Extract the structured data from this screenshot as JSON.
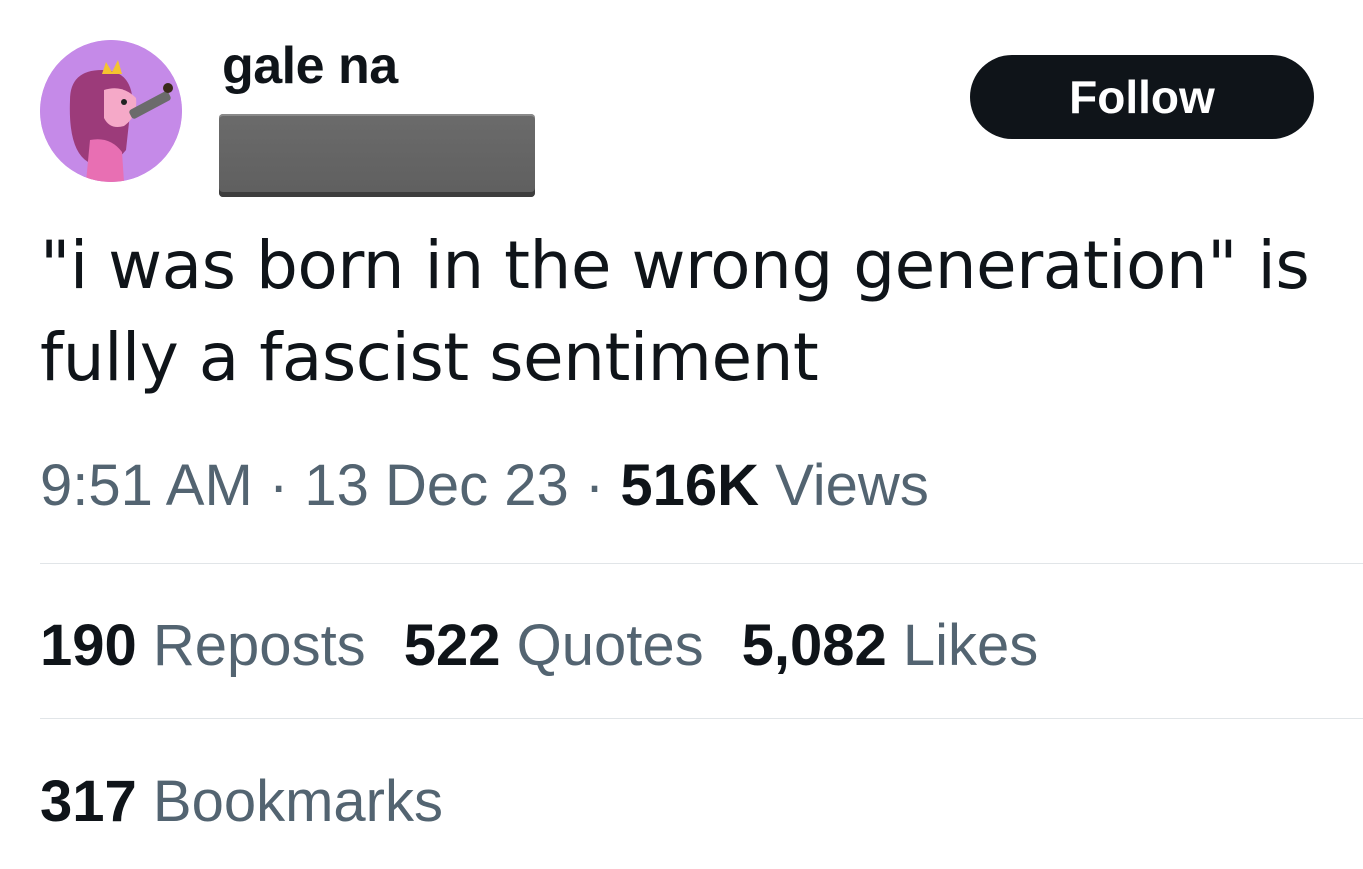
{
  "user": {
    "display_name": "gale na",
    "avatar_icon": "princess-bubblegum-avatar-icon",
    "avatar_bg": "#c58ae8"
  },
  "follow_button": {
    "label": "Follow"
  },
  "tweet": {
    "line1": "\"i was born in the wrong generation\" is",
    "line2": "fully a fascist sentiment"
  },
  "meta": {
    "time": "9:51 AM",
    "separator": "·",
    "date": "13 Dec 23",
    "views_count": "516K",
    "views_label": "Views"
  },
  "stats": {
    "reposts_count": "190",
    "reposts_label": "Reposts",
    "quotes_count": "522",
    "quotes_label": "Quotes",
    "likes_count": "5,082",
    "likes_label": "Likes",
    "bookmarks_count": "317",
    "bookmarks_label": "Bookmarks"
  },
  "colors": {
    "text_primary": "#0f1419",
    "text_secondary": "#536471",
    "divider": "#e1e5e8",
    "button_bg": "#0f1419"
  }
}
